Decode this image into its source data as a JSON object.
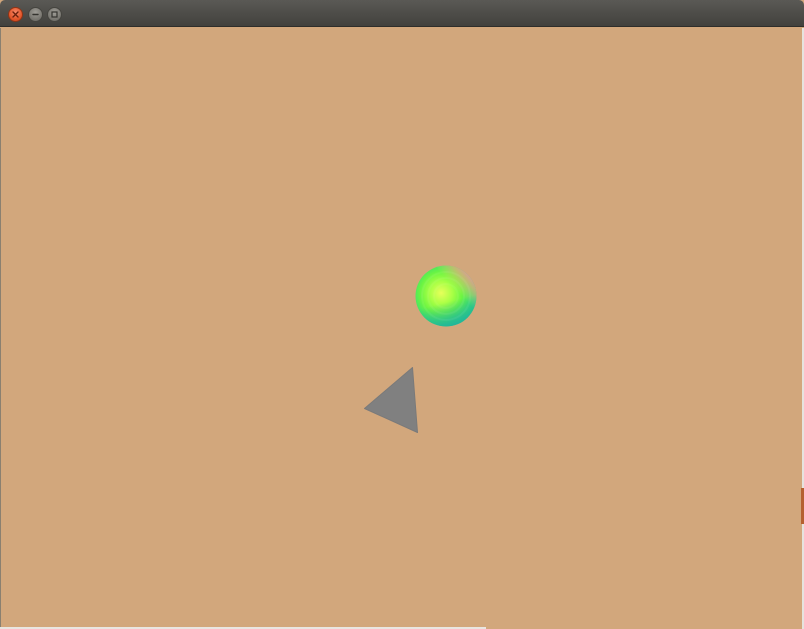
{
  "window": {
    "title": "",
    "background_color": "#d2a77c",
    "controls": {
      "close_icon": "close-icon",
      "minimize_icon": "minimize-icon",
      "maximize_icon": "maximize-icon"
    }
  },
  "scene": {
    "objects": [
      {
        "kind": "sphere",
        "shading": "rainbow-normal-colored"
      },
      {
        "kind": "triangle",
        "color": "#808080"
      }
    ]
  }
}
